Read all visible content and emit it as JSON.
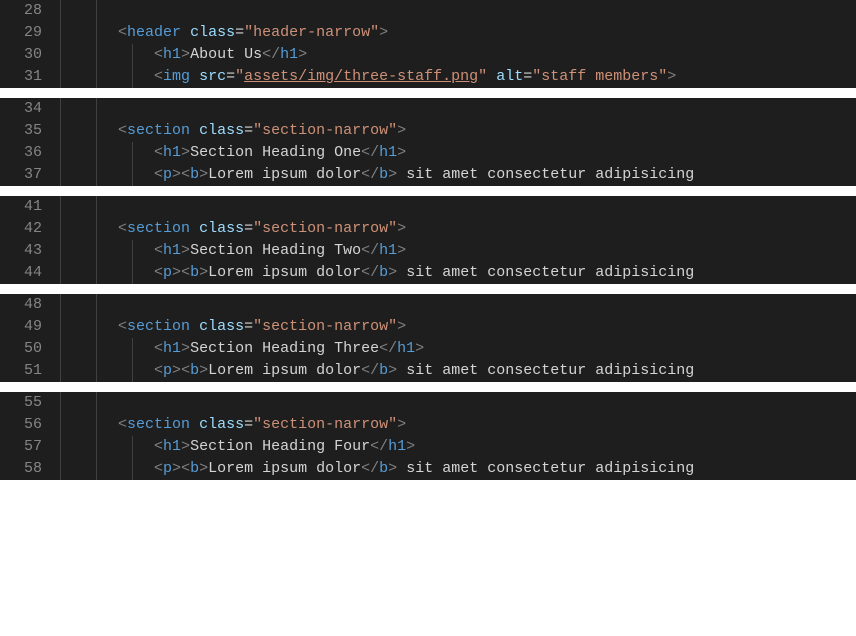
{
  "blocks": [
    {
      "lines": [
        {
          "num": "28",
          "indent": 1,
          "segs": []
        },
        {
          "num": "29",
          "indent": 1,
          "segs": [
            {
              "t": "pad",
              "v": "    "
            },
            {
              "t": "br",
              "v": "<"
            },
            {
              "t": "tag",
              "v": "header"
            },
            {
              "t": "text",
              "v": " "
            },
            {
              "t": "attr",
              "v": "class"
            },
            {
              "t": "eq",
              "v": "="
            },
            {
              "t": "str",
              "v": "\"header-narrow\""
            },
            {
              "t": "br",
              "v": ">"
            }
          ]
        },
        {
          "num": "30",
          "indent": 2,
          "segs": [
            {
              "t": "pad",
              "v": "        "
            },
            {
              "t": "br",
              "v": "<"
            },
            {
              "t": "tag",
              "v": "h1"
            },
            {
              "t": "br",
              "v": ">"
            },
            {
              "t": "text",
              "v": "About Us"
            },
            {
              "t": "br",
              "v": "</"
            },
            {
              "t": "tag",
              "v": "h1"
            },
            {
              "t": "br",
              "v": ">"
            }
          ]
        },
        {
          "num": "31",
          "indent": 2,
          "segs": [
            {
              "t": "pad",
              "v": "        "
            },
            {
              "t": "br",
              "v": "<"
            },
            {
              "t": "tag",
              "v": "img"
            },
            {
              "t": "text",
              "v": " "
            },
            {
              "t": "attr",
              "v": "src"
            },
            {
              "t": "eq",
              "v": "="
            },
            {
              "t": "str",
              "v": "\""
            },
            {
              "t": "str-u",
              "v": "assets/img/three-staff.png"
            },
            {
              "t": "str",
              "v": "\""
            },
            {
              "t": "text",
              "v": " "
            },
            {
              "t": "attr",
              "v": "alt"
            },
            {
              "t": "eq",
              "v": "="
            },
            {
              "t": "str",
              "v": "\"staff members\""
            },
            {
              "t": "br",
              "v": ">"
            }
          ]
        }
      ]
    },
    {
      "lines": [
        {
          "num": "34",
          "indent": 1,
          "segs": []
        },
        {
          "num": "35",
          "indent": 1,
          "segs": [
            {
              "t": "pad",
              "v": "    "
            },
            {
              "t": "br",
              "v": "<"
            },
            {
              "t": "tag",
              "v": "section"
            },
            {
              "t": "text",
              "v": " "
            },
            {
              "t": "attr",
              "v": "class"
            },
            {
              "t": "eq",
              "v": "="
            },
            {
              "t": "str",
              "v": "\"section-narrow\""
            },
            {
              "t": "br",
              "v": ">"
            }
          ]
        },
        {
          "num": "36",
          "indent": 2,
          "segs": [
            {
              "t": "pad",
              "v": "        "
            },
            {
              "t": "br",
              "v": "<"
            },
            {
              "t": "tag",
              "v": "h1"
            },
            {
              "t": "br",
              "v": ">"
            },
            {
              "t": "text",
              "v": "Section Heading One"
            },
            {
              "t": "br",
              "v": "</"
            },
            {
              "t": "tag",
              "v": "h1"
            },
            {
              "t": "br",
              "v": ">"
            }
          ]
        },
        {
          "num": "37",
          "indent": 2,
          "segs": [
            {
              "t": "pad",
              "v": "        "
            },
            {
              "t": "br",
              "v": "<"
            },
            {
              "t": "tag",
              "v": "p"
            },
            {
              "t": "br",
              "v": ">"
            },
            {
              "t": "br",
              "v": "<"
            },
            {
              "t": "tag",
              "v": "b"
            },
            {
              "t": "br",
              "v": ">"
            },
            {
              "t": "text",
              "v": "Lorem ipsum dolor"
            },
            {
              "t": "br",
              "v": "</"
            },
            {
              "t": "tag",
              "v": "b"
            },
            {
              "t": "br",
              "v": ">"
            },
            {
              "t": "text",
              "v": " sit amet consectetur adipisicing"
            }
          ]
        }
      ]
    },
    {
      "lines": [
        {
          "num": "41",
          "indent": 1,
          "segs": []
        },
        {
          "num": "42",
          "indent": 1,
          "segs": [
            {
              "t": "pad",
              "v": "    "
            },
            {
              "t": "br",
              "v": "<"
            },
            {
              "t": "tag",
              "v": "section"
            },
            {
              "t": "text",
              "v": " "
            },
            {
              "t": "attr",
              "v": "class"
            },
            {
              "t": "eq",
              "v": "="
            },
            {
              "t": "str",
              "v": "\"section-narrow\""
            },
            {
              "t": "br",
              "v": ">"
            }
          ]
        },
        {
          "num": "43",
          "indent": 2,
          "segs": [
            {
              "t": "pad",
              "v": "        "
            },
            {
              "t": "br",
              "v": "<"
            },
            {
              "t": "tag",
              "v": "h1"
            },
            {
              "t": "br",
              "v": ">"
            },
            {
              "t": "text",
              "v": "Section Heading Two"
            },
            {
              "t": "br",
              "v": "</"
            },
            {
              "t": "tag",
              "v": "h1"
            },
            {
              "t": "br",
              "v": ">"
            }
          ]
        },
        {
          "num": "44",
          "indent": 2,
          "segs": [
            {
              "t": "pad",
              "v": "        "
            },
            {
              "t": "br",
              "v": "<"
            },
            {
              "t": "tag",
              "v": "p"
            },
            {
              "t": "br",
              "v": ">"
            },
            {
              "t": "br",
              "v": "<"
            },
            {
              "t": "tag",
              "v": "b"
            },
            {
              "t": "br",
              "v": ">"
            },
            {
              "t": "text",
              "v": "Lorem ipsum dolor"
            },
            {
              "t": "br",
              "v": "</"
            },
            {
              "t": "tag",
              "v": "b"
            },
            {
              "t": "br",
              "v": ">"
            },
            {
              "t": "text",
              "v": " sit amet consectetur adipisicing"
            }
          ]
        }
      ]
    },
    {
      "lines": [
        {
          "num": "48",
          "indent": 1,
          "segs": []
        },
        {
          "num": "49",
          "indent": 1,
          "segs": [
            {
              "t": "pad",
              "v": "    "
            },
            {
              "t": "br",
              "v": "<"
            },
            {
              "t": "tag",
              "v": "section"
            },
            {
              "t": "text",
              "v": " "
            },
            {
              "t": "attr",
              "v": "class"
            },
            {
              "t": "eq",
              "v": "="
            },
            {
              "t": "str",
              "v": "\"section-narrow\""
            },
            {
              "t": "br",
              "v": ">"
            }
          ]
        },
        {
          "num": "50",
          "indent": 2,
          "segs": [
            {
              "t": "pad",
              "v": "        "
            },
            {
              "t": "br",
              "v": "<"
            },
            {
              "t": "tag",
              "v": "h1"
            },
            {
              "t": "br",
              "v": ">"
            },
            {
              "t": "text",
              "v": "Section Heading Three"
            },
            {
              "t": "br",
              "v": "</"
            },
            {
              "t": "tag",
              "v": "h1"
            },
            {
              "t": "br",
              "v": ">"
            }
          ]
        },
        {
          "num": "51",
          "indent": 2,
          "segs": [
            {
              "t": "pad",
              "v": "        "
            },
            {
              "t": "br",
              "v": "<"
            },
            {
              "t": "tag",
              "v": "p"
            },
            {
              "t": "br",
              "v": ">"
            },
            {
              "t": "br",
              "v": "<"
            },
            {
              "t": "tag",
              "v": "b"
            },
            {
              "t": "br",
              "v": ">"
            },
            {
              "t": "text",
              "v": "Lorem ipsum dolor"
            },
            {
              "t": "br",
              "v": "</"
            },
            {
              "t": "tag",
              "v": "b"
            },
            {
              "t": "br",
              "v": ">"
            },
            {
              "t": "text",
              "v": " sit amet consectetur adipisicing"
            }
          ]
        }
      ]
    },
    {
      "lines": [
        {
          "num": "55",
          "indent": 1,
          "segs": []
        },
        {
          "num": "56",
          "indent": 1,
          "segs": [
            {
              "t": "pad",
              "v": "    "
            },
            {
              "t": "br",
              "v": "<"
            },
            {
              "t": "tag",
              "v": "section"
            },
            {
              "t": "text",
              "v": " "
            },
            {
              "t": "attr",
              "v": "class"
            },
            {
              "t": "eq",
              "v": "="
            },
            {
              "t": "str",
              "v": "\"section-narrow\""
            },
            {
              "t": "br",
              "v": ">"
            }
          ]
        },
        {
          "num": "57",
          "indent": 2,
          "segs": [
            {
              "t": "pad",
              "v": "        "
            },
            {
              "t": "br",
              "v": "<"
            },
            {
              "t": "tag",
              "v": "h1"
            },
            {
              "t": "br",
              "v": ">"
            },
            {
              "t": "text",
              "v": "Section Heading Four"
            },
            {
              "t": "br",
              "v": "</"
            },
            {
              "t": "tag",
              "v": "h1"
            },
            {
              "t": "br",
              "v": ">"
            }
          ]
        },
        {
          "num": "58",
          "indent": 2,
          "segs": [
            {
              "t": "pad",
              "v": "        "
            },
            {
              "t": "br",
              "v": "<"
            },
            {
              "t": "tag",
              "v": "p"
            },
            {
              "t": "br",
              "v": ">"
            },
            {
              "t": "br",
              "v": "<"
            },
            {
              "t": "tag",
              "v": "b"
            },
            {
              "t": "br",
              "v": ">"
            },
            {
              "t": "text",
              "v": "Lorem ipsum dolor"
            },
            {
              "t": "br",
              "v": "</"
            },
            {
              "t": "tag",
              "v": "b"
            },
            {
              "t": "br",
              "v": ">"
            },
            {
              "t": "text",
              "v": " sit amet consectetur adipisicing"
            }
          ]
        }
      ]
    }
  ]
}
